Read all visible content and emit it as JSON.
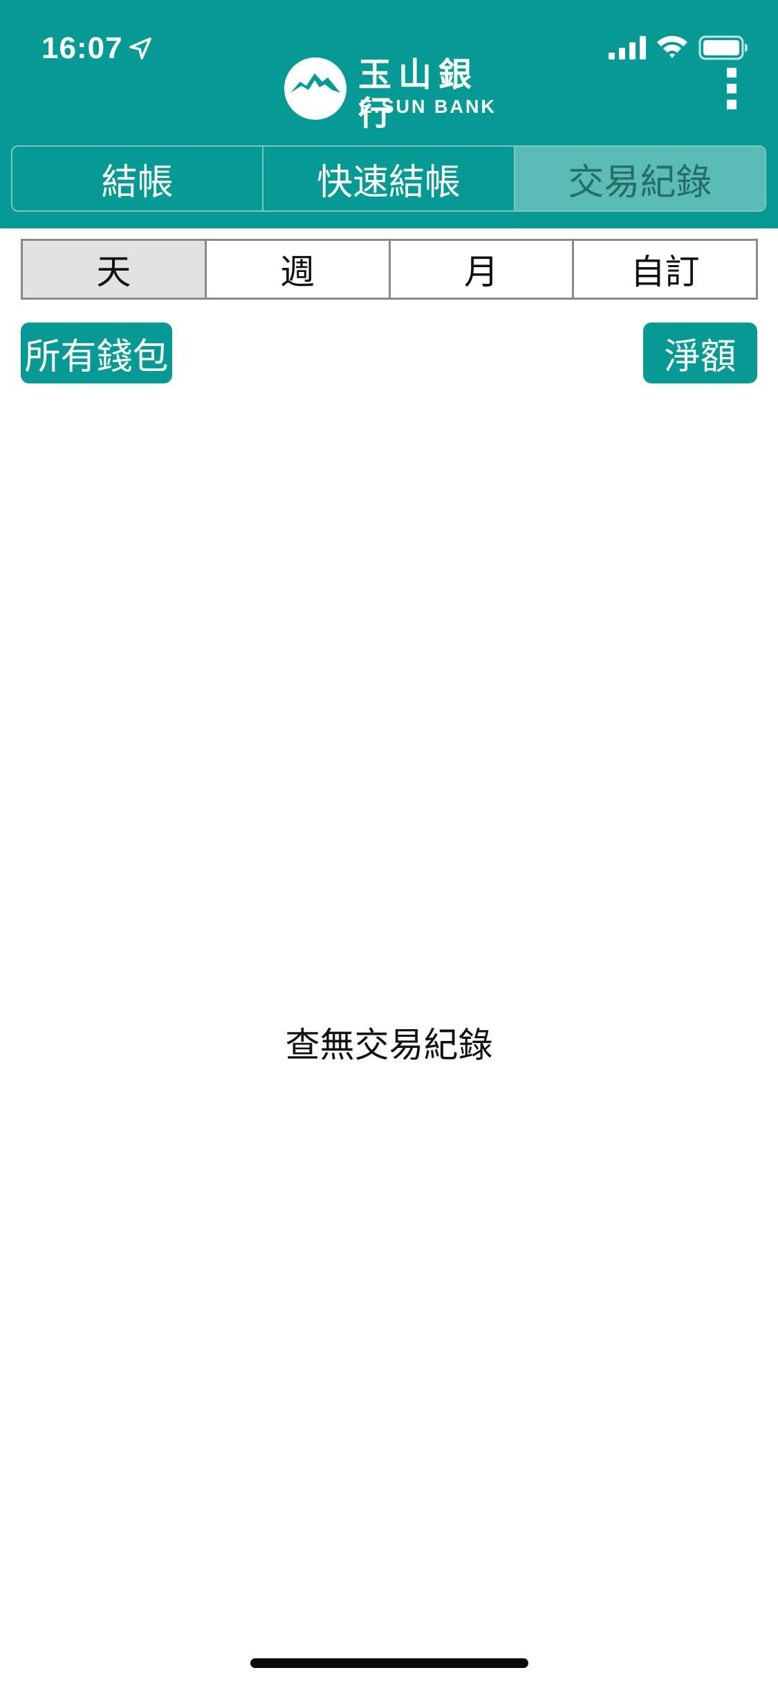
{
  "status_bar": {
    "time": "16:07",
    "location_icon": "location-arrow-icon",
    "signal_icon": "cellular-signal-icon",
    "wifi_icon": "wifi-icon",
    "battery_icon": "battery-icon"
  },
  "header": {
    "logo_cn": "玉山銀行",
    "logo_en": "E.SUN BANK",
    "menu_icon": "more-vertical-icon",
    "background_color": "#079a94"
  },
  "main_tabs": [
    {
      "label": "結帳",
      "active": false
    },
    {
      "label": "快速結帳",
      "active": false
    },
    {
      "label": "交易紀錄",
      "active": true
    }
  ],
  "period_tabs": [
    {
      "label": "天",
      "selected": true
    },
    {
      "label": "週",
      "selected": false
    },
    {
      "label": "月",
      "selected": false
    },
    {
      "label": "自訂",
      "selected": false
    }
  ],
  "filters": {
    "wallet_label": "所有錢包",
    "net_label": "淨額"
  },
  "empty_state": {
    "message": "查無交易紀錄"
  },
  "colors": {
    "brand": "#079a94",
    "active_tab": "#5bbcb5",
    "selected_period": "#e2e2e2"
  }
}
